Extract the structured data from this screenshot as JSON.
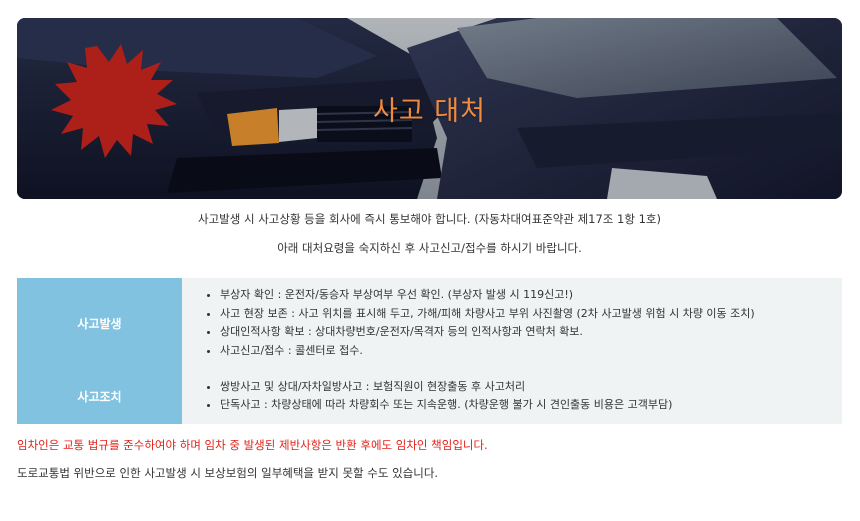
{
  "hero": {
    "title": "사고 대처",
    "image_alt": "두 대의 차량 충돌 사진"
  },
  "intro": {
    "line1": "사고발생 시 사고상황 등을 회사에 즉시 통보해야 합니다. (자동차대여표준약관 제17조 1항 1호)",
    "line2": "아래 대처요령을 숙지하신 후 사고신고/접수를 하시기 바랍니다."
  },
  "guide": {
    "rows": [
      {
        "header": "사고발생",
        "items": [
          "부상자 확인 : 운전자/동승자 부상여부 우선 확인. (부상자 발생 시 119신고!)",
          "사고 현장 보존 : 사고 위치를 표시해 두고, 가해/피해 차량사고 부위 사진촬영 (2차 사고발생 위험 시 차량 이동 조치)",
          "상대인적사항 확보 : 상대차량번호/운전자/목격자 등의 인적사항과 연락처 확보.",
          "사고신고/접수 : 콜센터로 접수."
        ]
      },
      {
        "header": "사고조치",
        "items": [
          "쌍방사고 및 상대/자차일방사고 : 보험직원이 현장출동 후 사고처리",
          "단독사고 : 차량상태에 따라 차량회수 또는 지속운행. (차량운행 불가 시 견인출동 비용은 고객부담)"
        ]
      }
    ]
  },
  "notice": "임차인은 교통 법규를 준수하여야 하며 임차 중 발생된 제반사항은 반환 후에도 임차인 책임입니다.",
  "note": "도로교통법 위반으로 인한 사고발생 시 보상보험의 일부혜택을 받지 못할 수도 있습니다.",
  "colors": {
    "accent_title": "#f08a3c",
    "table_header": "#80c2e0",
    "table_body": "#eff3f3",
    "notice_red": "#e2231a"
  }
}
